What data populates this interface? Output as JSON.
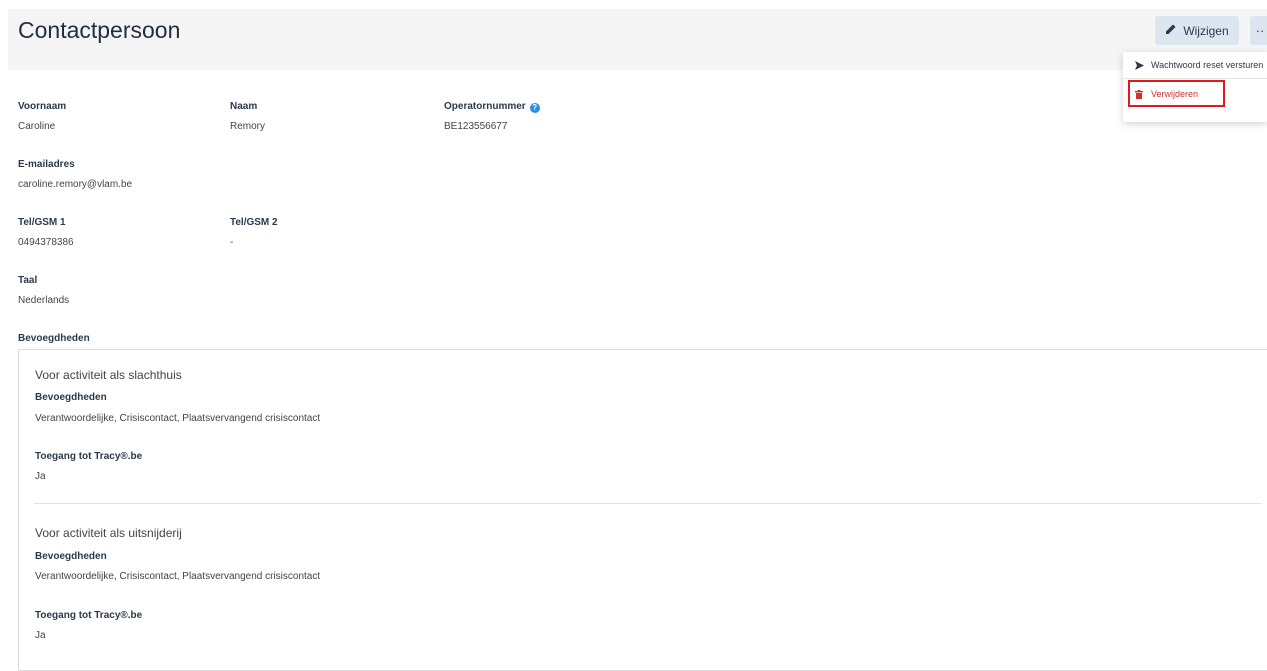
{
  "header": {
    "title": "Contactpersoon",
    "edit_label": "Wijzigen",
    "more_label": "··"
  },
  "menu": {
    "reset_password": "Wachtwoord reset versturen",
    "delete": "Verwijderen"
  },
  "fields": {
    "voornaam_label": "Voornaam",
    "voornaam": "Caroline",
    "naam_label": "Naam",
    "naam": "Remory",
    "operator_label": "Operatornummer",
    "operator": "BE123556677",
    "email_label": "E-mailadres",
    "email": "caroline.remory@vlam.be",
    "tel1_label": "Tel/GSM 1",
    "tel1": "0494378386",
    "tel2_label": "Tel/GSM 2",
    "tel2": "-",
    "taal_label": "Taal",
    "taal": "Nederlands"
  },
  "permissions": {
    "label": "Bevoegdheden",
    "activities": [
      {
        "title": "Voor activiteit als slachthuis",
        "perm_label": "Bevoegdheden",
        "perm_value": "Verantwoordelijke, Crisiscontact, Plaatsvervangend crisiscontact",
        "access_label": "Toegang tot Tracy®.be",
        "access_value": "Ja"
      },
      {
        "title": "Voor activiteit als uitsnijderij",
        "perm_label": "Bevoegdheden",
        "perm_value": "Verantwoordelijke, Crisiscontact, Plaatsvervangend crisiscontact",
        "access_label": "Toegang tot Tracy®.be",
        "access_value": "Ja"
      }
    ]
  },
  "icons": {
    "edit": "pencil-icon",
    "send": "send-icon",
    "delete": "trash-icon",
    "info": "info-icon"
  },
  "colors": {
    "button_bg": "#dbe6f1",
    "delete_red": "#d0312d",
    "highlight": "#e0191e",
    "info_blue": "#2a8ee0"
  }
}
